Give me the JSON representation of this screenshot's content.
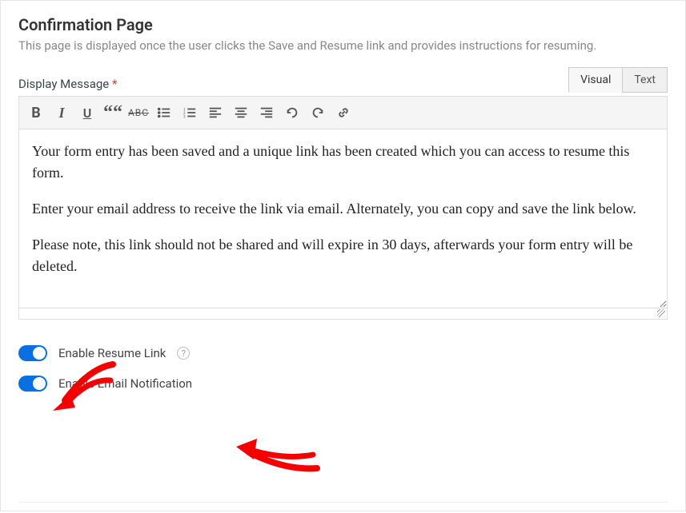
{
  "section": {
    "title": "Confirmation Page",
    "description": "This page is displayed once the user clicks the Save and Resume link and provides instructions for resuming."
  },
  "field": {
    "label": "Display Message",
    "required_marker": "*"
  },
  "editor": {
    "tabs": {
      "visual": "Visual",
      "text": "Text"
    },
    "toolbar": {
      "bold": "B",
      "italic": "I",
      "underline": "U",
      "blockquote": "““",
      "strike": "ABC"
    },
    "content": {
      "p1": "Your form entry has been saved and a unique link has been created which you can access to resume this form.",
      "p2": "Enter your email address to receive the link via email. Alternately, you can copy and save the link below.",
      "p3": "Please note, this link should not be shared and will expire in 30 days, afterwards your form entry will be deleted."
    }
  },
  "toggles": {
    "resume_link": {
      "label": "Enable Resume Link",
      "enabled": true
    },
    "email_notification": {
      "label": "Enable Email Notification",
      "enabled": true
    }
  },
  "help_glyph": "?"
}
